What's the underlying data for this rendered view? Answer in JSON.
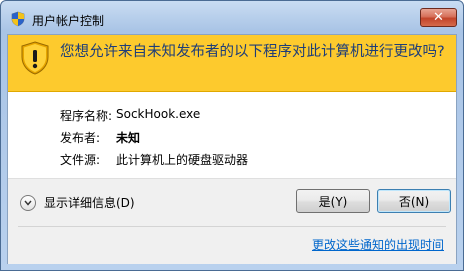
{
  "window": {
    "title": "用户帐户控制",
    "close_glyph": "✕"
  },
  "banner": {
    "message": "您想允许来自未知发布者的以下程序对此计算机进行更改吗?",
    "color": "#fdca2d",
    "icon": "uac-shield-warning-icon"
  },
  "details": {
    "program_label": "程序名称:",
    "program_value": "SockHook.exe",
    "publisher_label": "发布者:",
    "publisher_value": "未知",
    "source_label": "文件源:",
    "source_value": "此计算机上的硬盘驱动器"
  },
  "footer": {
    "show_details": "显示详细信息(D)",
    "yes_label": "是(Y)",
    "no_label": "否(N)",
    "link": "更改这些通知的出现时间"
  }
}
